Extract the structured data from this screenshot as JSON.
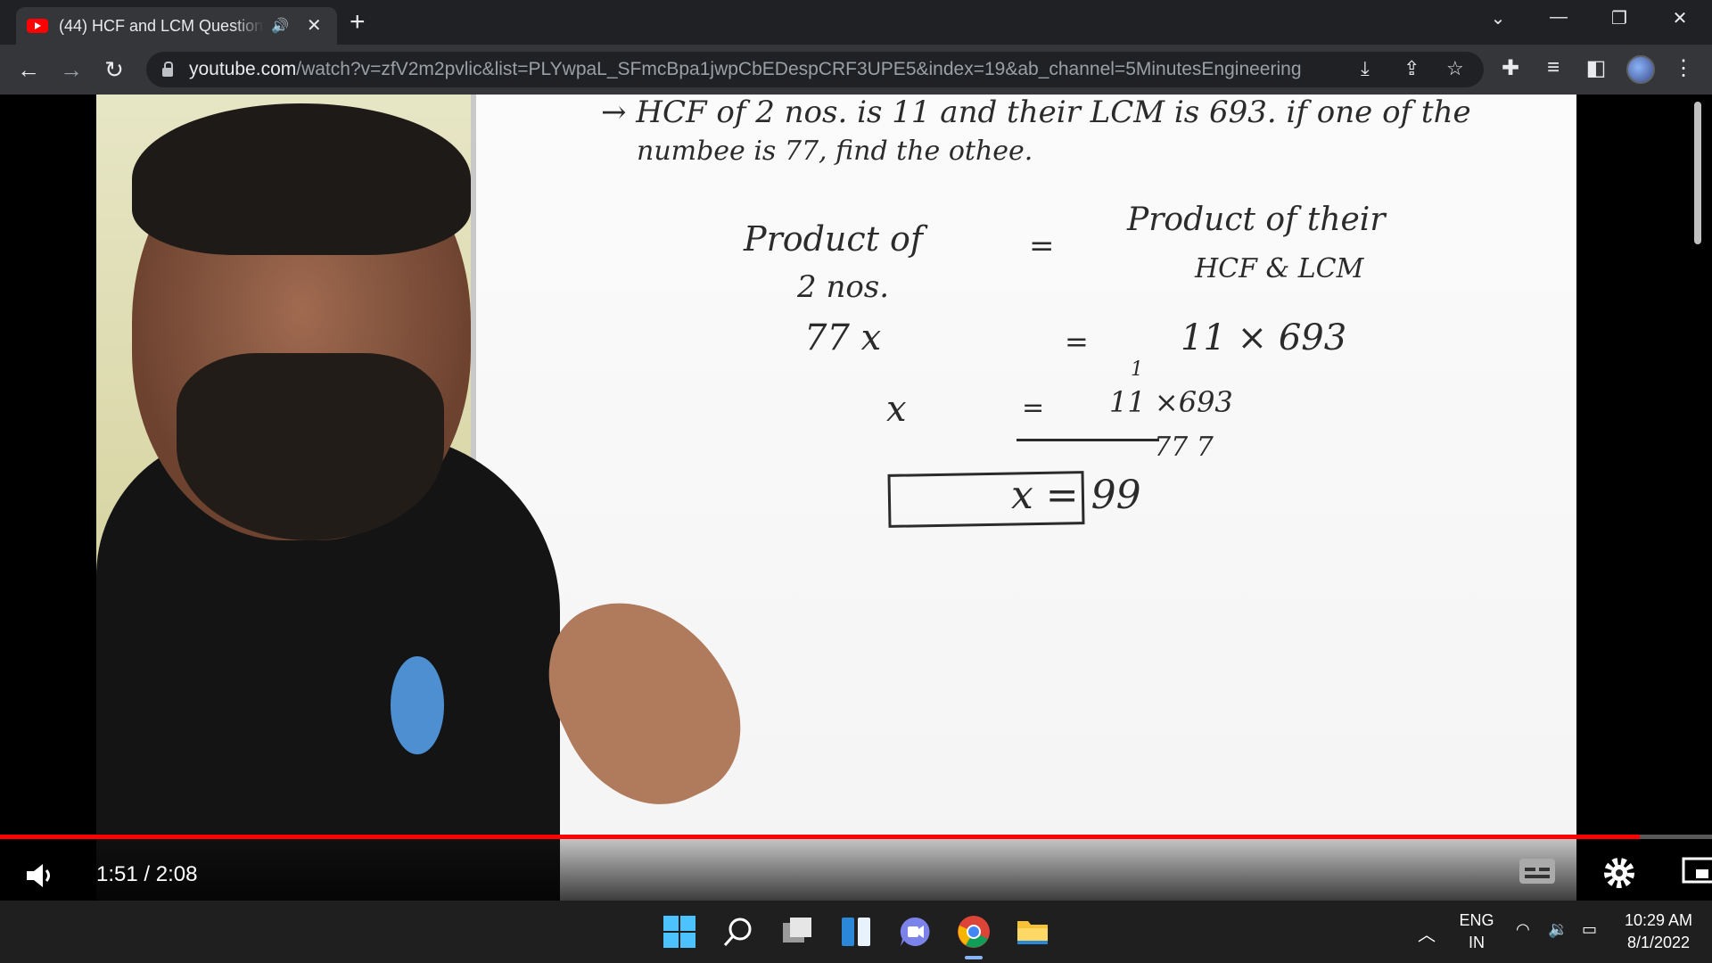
{
  "browser": {
    "tab_title": "(44) HCF and LCM Question",
    "url_host": "youtube.com",
    "url_path": "/watch?v=zfV2m2pvlic&list=PLYwpaL_SFmcBpa1jwpCbEDespCRF3UPE5&index=19&ab_channel=5MinutesEngineering"
  },
  "board": {
    "line1": "→ HCF of 2 nos. is 11 and their LCM is 693. if one of the",
    "line2": "numbee is 77, find the othee.",
    "left_label_1": "Product of",
    "left_label_2": "2 nos.",
    "eq1": "=",
    "right_label_1": "Product of their",
    "right_label_2": "HCF & LCM",
    "step1_left": "77 x",
    "eq2": "=",
    "step1_right": "11 × 693",
    "step2_left": "x",
    "eq3": "=",
    "step2_cancel_mark": "1",
    "step2_numerator": "11 ×693",
    "step2_denominator": "77 7",
    "answer": "x = 99"
  },
  "player": {
    "time_display": "1:51 / 2:08",
    "progress_fraction": 0.958
  },
  "taskbar": {
    "lang_top": "ENG",
    "lang_bottom": "IN",
    "clock_time": "10:29 AM",
    "clock_date": "8/1/2022"
  },
  "colors": {
    "progress": "#ff0000",
    "yt_red": "#ff0000",
    "chrome_dark": "#202124"
  }
}
